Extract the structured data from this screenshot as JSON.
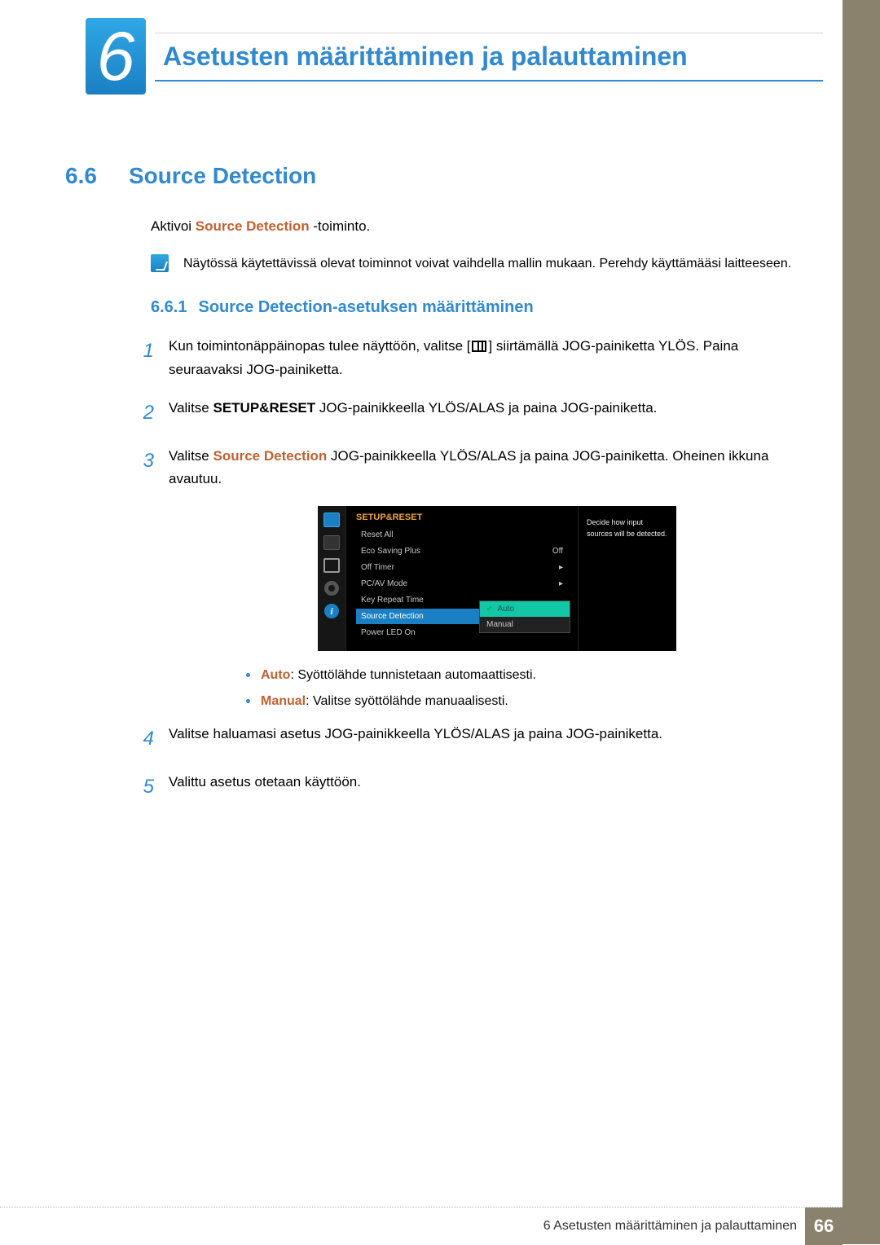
{
  "chapter": {
    "number": "6",
    "title": "Asetusten määrittäminen ja palauttaminen"
  },
  "section": {
    "number": "6.6",
    "title": "Source Detection",
    "intro_prefix": "Aktivoi ",
    "intro_term": "Source Detection",
    "intro_suffix": " -toiminto."
  },
  "note": "Näytössä käytettävissä olevat toiminnot voivat vaihdella mallin mukaan. Perehdy käyttämääsi laitteeseen.",
  "subsection": {
    "number": "6.6.1",
    "title": "Source Detection-asetuksen määrittäminen"
  },
  "steps": {
    "s1a": "Kun toimintonäppäinopas tulee näyttöön, valitse [",
    "s1b": "] siirtämällä JOG-painiketta YLÖS. Paina seuraavaksi JOG-painiketta.",
    "s2a": "Valitse ",
    "s2_term": "SETUP&RESET",
    "s2b": " JOG-painikkeella YLÖS/ALAS ja paina JOG-painiketta.",
    "s3a": "Valitse ",
    "s3_term": "Source Detection",
    "s3b": " JOG-painikkeella YLÖS/ALAS ja paina JOG-painiketta. Oheinen ikkuna avautuu.",
    "s4": "Valitse haluamasi asetus JOG-painikkeella YLÖS/ALAS ja paina JOG-painiketta.",
    "s5": "Valittu asetus otetaan käyttöön."
  },
  "bullets": {
    "auto_term": "Auto",
    "auto_text": ": Syöttölähde tunnistetaan automaattisesti.",
    "manual_term": "Manual",
    "manual_text": ": Valitse syöttölähde manuaalisesti."
  },
  "osd": {
    "title": "SETUP&RESET",
    "rows": {
      "resetAll": "Reset All",
      "eco": "Eco Saving Plus",
      "eco_val": "Off",
      "offtimer": "Off Timer",
      "pcav": "PC/AV Mode",
      "keyrep": "Key Repeat Time",
      "srcdet": "Source Detection",
      "powerled": "Power LED On"
    },
    "popup": {
      "auto": "Auto",
      "manual": "Manual"
    },
    "help": "Decide how input sources will be detected."
  },
  "footer": {
    "text": "6 Asetusten määrittäminen ja palauttaminen",
    "page": "66"
  }
}
